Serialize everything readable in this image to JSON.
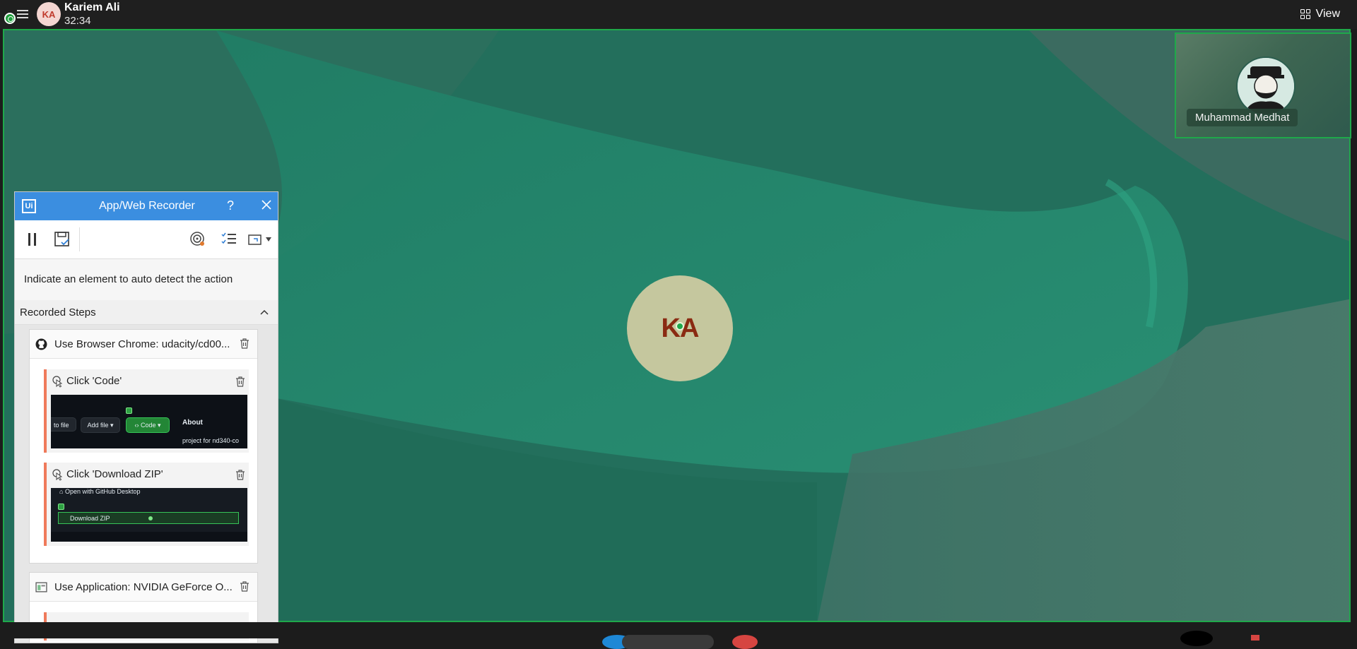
{
  "topbar": {
    "avatar_initials": "KA",
    "user_name": "Kariem Ali",
    "timer": "32:34",
    "view_label": "View"
  },
  "main_video": {
    "avatar_initials": "KA",
    "border_color": "#1fa84a"
  },
  "participant": {
    "name": "Muhammad Medhat"
  },
  "recorder": {
    "logo_text": "Ui",
    "title": "App/Web Recorder",
    "help_label": "?",
    "hint": "Indicate an element to auto detect the action",
    "steps_header": "Recorded Steps",
    "scopes": [
      {
        "icon": "github-icon",
        "label": "Use Browser Chrome: udacity/cd00...",
        "steps": [
          {
            "label": "Click 'Code'",
            "thumb": {
              "btn_to_file": "to file",
              "btn_add_file": "Add file",
              "btn_code": "Code",
              "about": "About",
              "desc": "project for nd340-co"
            }
          },
          {
            "label": "Click 'Download ZIP'",
            "thumb": {
              "open_desktop": "Open with GitHub Desktop",
              "download_zip": "Download ZIP"
            }
          }
        ]
      },
      {
        "icon": "application-icon",
        "label": "Use Application: NVIDIA GeForce O..."
      }
    ]
  },
  "colors": {
    "accent_blue": "#3b8ee0",
    "active_green": "#1fa84a",
    "step_accent": "#ef7a5b"
  }
}
